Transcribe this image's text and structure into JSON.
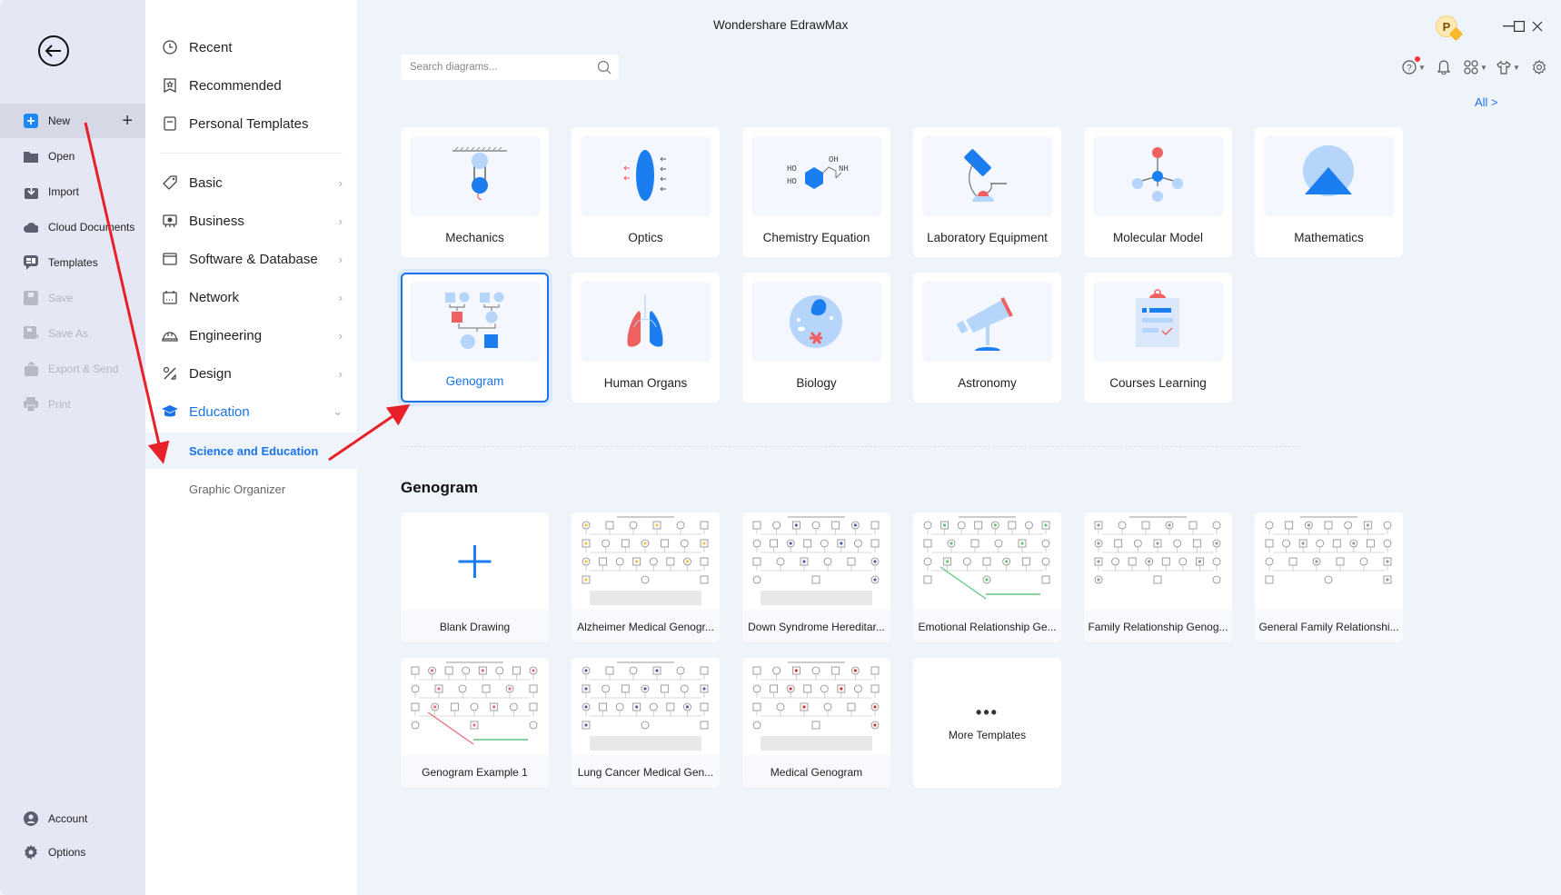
{
  "window": {
    "title": "Wondershare EdrawMax",
    "avatar_letter": "P",
    "controls": [
      "minimize-icon",
      "maximize-icon",
      "close-icon"
    ]
  },
  "left_nav": {
    "back_icon": "back-arrow-icon",
    "items": [
      {
        "label": "New",
        "icon": "new-icon",
        "active": true,
        "disabled": false
      },
      {
        "label": "Open",
        "icon": "folder-icon",
        "disabled": false
      },
      {
        "label": "Import",
        "icon": "import-icon",
        "disabled": false
      },
      {
        "label": "Cloud Documents",
        "icon": "cloud-icon",
        "disabled": false
      },
      {
        "label": "Templates",
        "icon": "templates-icon",
        "disabled": false
      },
      {
        "label": "Save",
        "icon": "save-icon",
        "disabled": true
      },
      {
        "label": "Save As",
        "icon": "save-as-icon",
        "disabled": true
      },
      {
        "label": "Export & Send",
        "icon": "export-icon",
        "disabled": true
      },
      {
        "label": "Print",
        "icon": "print-icon",
        "disabled": true
      }
    ],
    "bottom": [
      {
        "label": "Account",
        "icon": "account-icon"
      },
      {
        "label": "Options",
        "icon": "gear-icon"
      }
    ]
  },
  "categories": {
    "top": [
      {
        "label": "Recent",
        "icon": "clock-icon"
      },
      {
        "label": "Recommended",
        "icon": "star-badge-icon"
      },
      {
        "label": "Personal Templates",
        "icon": "document-icon"
      }
    ],
    "main": [
      {
        "label": "Basic",
        "icon": "tag-icon",
        "chevron": "›"
      },
      {
        "label": "Business",
        "icon": "presentation-icon",
        "chevron": "›"
      },
      {
        "label": "Software & Database",
        "icon": "window-icon",
        "chevron": "›"
      },
      {
        "label": "Network",
        "icon": "calendar-icon",
        "chevron": "›"
      },
      {
        "label": "Engineering",
        "icon": "hardhat-icon",
        "chevron": "›"
      },
      {
        "label": "Design",
        "icon": "design-tools-icon",
        "chevron": "›"
      },
      {
        "label": "Education",
        "icon": "graduation-cap-icon",
        "chevron": "⌄",
        "active": true
      }
    ],
    "sub": [
      {
        "label": "Science and Education",
        "active": true
      },
      {
        "label": "Graphic Organizer",
        "active": false
      }
    ]
  },
  "search": {
    "placeholder": "Search diagrams...",
    "value": ""
  },
  "toolbar": {
    "icons": [
      "help-icon",
      "bell-icon",
      "apps-icon",
      "shirt-icon",
      "settings-icon"
    ],
    "has_help_notification": true
  },
  "all_link": "All  >",
  "diagram_types": [
    {
      "label": "Mechanics",
      "icon": "mechanics-icon"
    },
    {
      "label": "Optics",
      "icon": "optics-icon"
    },
    {
      "label": "Chemistry Equation",
      "icon": "chemistry-icon"
    },
    {
      "label": "Laboratory Equipment",
      "icon": "microscope-icon"
    },
    {
      "label": "Molecular Model",
      "icon": "molecule-icon"
    },
    {
      "label": "Mathematics",
      "icon": "math-icon"
    },
    {
      "label": "Genogram",
      "icon": "genogram-icon",
      "selected": true
    },
    {
      "label": "Human Organs",
      "icon": "lungs-icon"
    },
    {
      "label": "Biology",
      "icon": "cell-icon"
    },
    {
      "label": "Astronomy",
      "icon": "telescope-icon"
    },
    {
      "label": "Courses Learning",
      "icon": "clipboard-icon"
    }
  ],
  "section_title": "Genogram",
  "templates": [
    {
      "label": "Blank Drawing",
      "kind": "blank"
    },
    {
      "label": "Alzheimer Medical Genogr...",
      "kind": "thumb"
    },
    {
      "label": "Down Syndrome Hereditar...",
      "kind": "thumb"
    },
    {
      "label": "Emotional Relationship Ge...",
      "kind": "thumb"
    },
    {
      "label": "Family Relationship Genog...",
      "kind": "thumb"
    },
    {
      "label": "General Family Relationshi...",
      "kind": "thumb"
    },
    {
      "label": "Genogram Example 1",
      "kind": "thumb"
    },
    {
      "label": "Lung Cancer Medical Gen...",
      "kind": "thumb"
    },
    {
      "label": "Medical Genogram",
      "kind": "thumb"
    },
    {
      "label": "More Templates",
      "kind": "more",
      "dots": "•••"
    }
  ],
  "colors": {
    "accent": "#1a73e8",
    "annotation_arrow": "#e8202a",
    "sidebar_bg": "#e5e7f4",
    "content_bg": "#eff3fa"
  }
}
